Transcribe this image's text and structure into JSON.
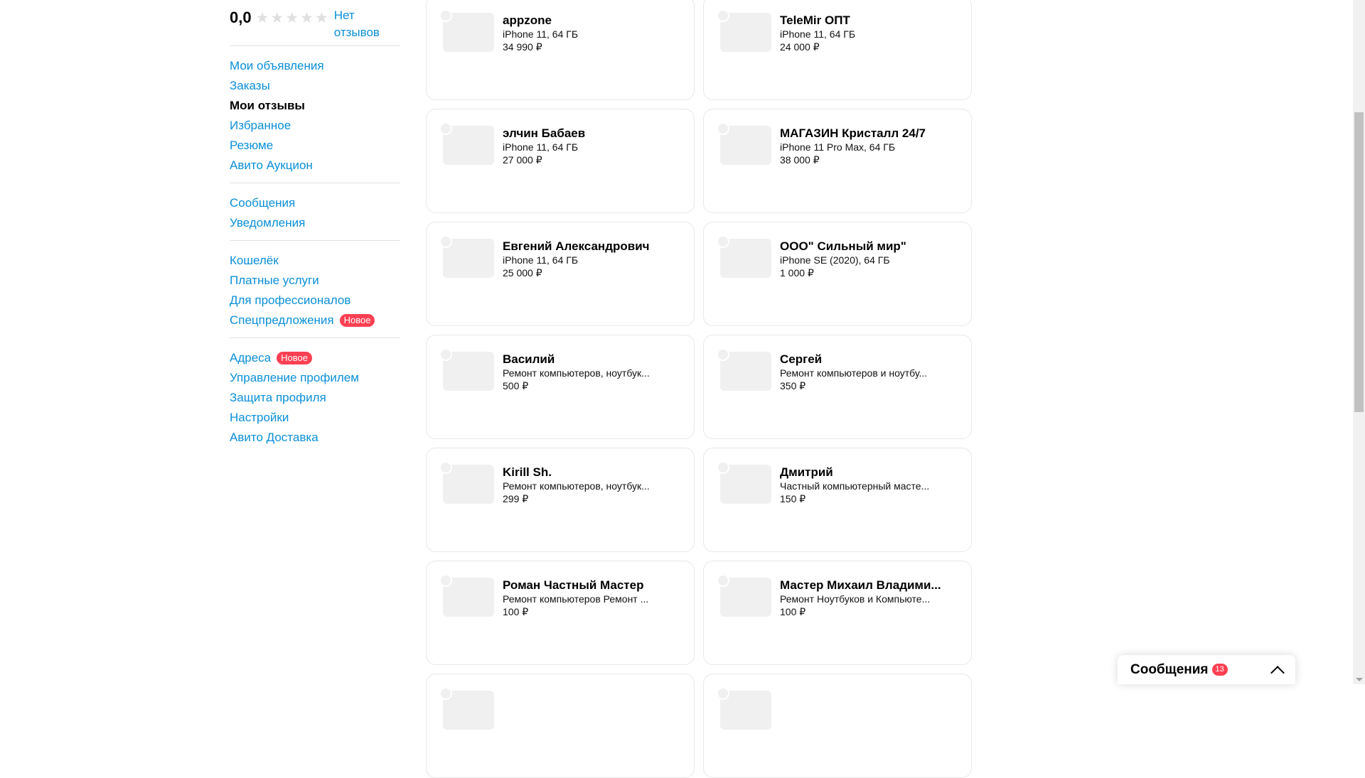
{
  "rating": {
    "value": "0,0",
    "stars_filled": 0,
    "stars_total": 5,
    "no_reviews": "Нет отзывов"
  },
  "sidebar": {
    "groups": [
      [
        {
          "label": "Мои объявления"
        },
        {
          "label": "Заказы"
        },
        {
          "label": "Мои отзывы",
          "active": true
        },
        {
          "label": "Избранное"
        },
        {
          "label": "Резюме"
        },
        {
          "label": "Авито Аукцион"
        }
      ],
      [
        {
          "label": "Сообщения"
        },
        {
          "label": "Уведомления"
        }
      ],
      [
        {
          "label": "Кошелёк"
        },
        {
          "label": "Платные услуги"
        },
        {
          "label": "Для профессионалов"
        },
        {
          "label": "Спецпредложения",
          "badge": "Новое"
        }
      ],
      [
        {
          "label": "Адреса",
          "badge": "Новое"
        },
        {
          "label": "Управление профилем"
        },
        {
          "label": "Защита профиля"
        },
        {
          "label": "Настройки"
        },
        {
          "label": "Авито Доставка"
        }
      ]
    ]
  },
  "cards": [
    {
      "name": "appzone",
      "item": "iPhone 11, 64 ГБ",
      "price": "34 990 ₽"
    },
    {
      "name": "TeleMir ОПТ",
      "item": "iPhone 11, 64 ГБ",
      "price": "24 000 ₽"
    },
    {
      "name": "элчин Бабаев",
      "item": "iPhone 11, 64 ГБ",
      "price": "27 000 ₽"
    },
    {
      "name": "МАГАЗИН Кристалл 24/7",
      "item": "iPhone 11 Pro Max, 64 ГБ",
      "price": "38 000 ₽"
    },
    {
      "name": "Евгений Александрович",
      "item": "iPhone 11, 64 ГБ",
      "price": "25 000 ₽"
    },
    {
      "name": "ООО\" Сильный мир\"",
      "item": "iPhone SE (2020), 64 ГБ",
      "price": "1 000 ₽"
    },
    {
      "name": "Василий",
      "item": "Ремонт компьютеров, ноутбук...",
      "price": "500 ₽"
    },
    {
      "name": "Сергей",
      "item": "Ремонт компьютеров и ноутбу...",
      "price": "350 ₽"
    },
    {
      "name": "Kirill Sh.",
      "item": "Ремонт компьютеров, ноутбук...",
      "price": "299 ₽"
    },
    {
      "name": "Дмитрий",
      "item": "Частный компьютерный масте...",
      "price": "150 ₽"
    },
    {
      "name": "Роман Частный Мастер",
      "item": "Ремонт компьютеров Ремонт ...",
      "price": "100 ₽"
    },
    {
      "name": "Мастер Михаил Владими...",
      "item": "Ремонт Ноутбуков и Компьюте...",
      "price": "100 ₽"
    },
    {
      "name": "",
      "item": "",
      "price": ""
    },
    {
      "name": "",
      "item": "",
      "price": ""
    }
  ],
  "messages_widget": {
    "title": "Сообщения",
    "count": "13"
  },
  "colors": {
    "link": "#0a8fd8",
    "badge": "#ff4053",
    "card_border": "#e8e8e8",
    "placeholder": "#f0f0f0"
  },
  "icons": {
    "star": "star-icon",
    "chevron": "chevron-up-icon"
  }
}
